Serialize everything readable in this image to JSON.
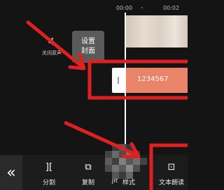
{
  "ruler": {
    "time_left": "00:00",
    "time_right": "00:02"
  },
  "mute": {
    "label": "关闭原声"
  },
  "cover": {
    "line1": "设置",
    "line2": "封面"
  },
  "text_clip": {
    "text": "1234567"
  },
  "toolbar": {
    "back_symbol": "«",
    "items": [
      {
        "label": "分割",
        "icon": "split-icon",
        "glyph": "]["
      },
      {
        "label": "复制",
        "icon": "copy-icon",
        "glyph": "⧉"
      },
      {
        "label": "jit",
        "icon": "edit-icon",
        "glyph": ""
      },
      {
        "label": "样式",
        "icon": "style-icon",
        "glyph": ""
      },
      {
        "label": "文本朗读",
        "icon": "text-to-speech-icon",
        "glyph": "⊡"
      }
    ]
  },
  "colors": {
    "accent": "#e98468",
    "annotation": "#e02020"
  }
}
